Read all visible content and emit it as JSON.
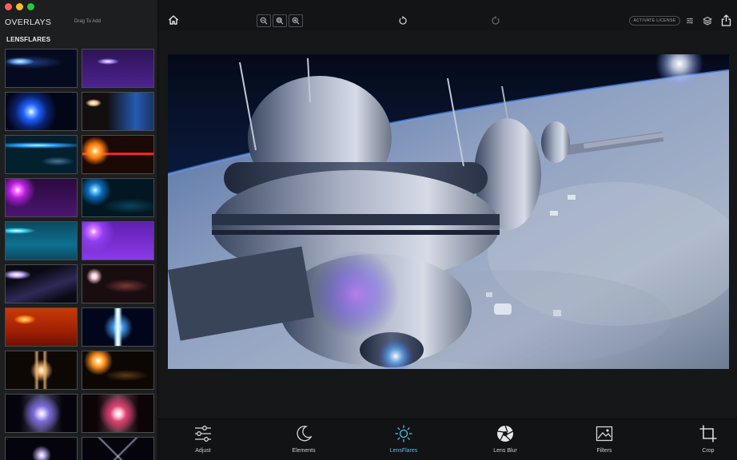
{
  "sidebar": {
    "title": "OVERLAYS",
    "hint": "Drag To Add",
    "section": "LENSFLARES"
  },
  "toolbar": {
    "license_label": "ACTIVATE LICENSE"
  },
  "bottom_tools": [
    {
      "label": "Adjust"
    },
    {
      "label": "Elements"
    },
    {
      "label": "LensFlares"
    },
    {
      "label": "Lens Blur"
    },
    {
      "label": "Filters"
    },
    {
      "label": "Crop"
    }
  ],
  "colors": {
    "accent": "#4fc4e8",
    "sidebar_bg": "#1d1e20",
    "toolbar_bg": "#131416"
  }
}
